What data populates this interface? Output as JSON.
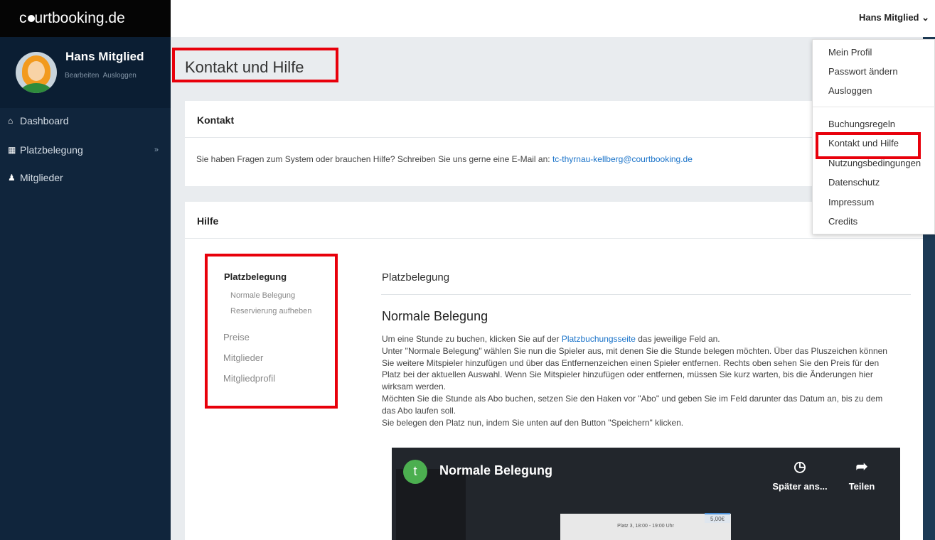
{
  "brand": {
    "pre": "c",
    "post": "urtbooking.de"
  },
  "user": {
    "name": "Hans Mitglied",
    "edit": "Bearbeiten",
    "logout": "Ausloggen"
  },
  "nav": [
    {
      "label": "Dashboard",
      "icon": "home-icon"
    },
    {
      "label": "Platzbelegung",
      "icon": "calendar-icon",
      "chevron": "»"
    },
    {
      "label": "Mitglieder",
      "icon": "person-icon"
    }
  ],
  "topbar": {
    "user_menu": "Hans Mitglied ⌄"
  },
  "page": {
    "title": "Kontakt und Hilfe"
  },
  "contact": {
    "heading": "Kontakt",
    "text": "Sie haben Fragen zum System oder brauchen Hilfe? Schreiben Sie uns gerne eine E-Mail an: ",
    "email": "tc-thyrnau-kellberg@courtbooking.de"
  },
  "help": {
    "heading": "Hilfe",
    "nav": {
      "active": "Platzbelegung",
      "sub1": "Normale Belegung",
      "sub2": "Reservierung aufheben",
      "item1": "Preise",
      "item2": "Mitglieder",
      "item3": "Mitgliedprofil"
    },
    "section_title": "Platzbelegung",
    "sub_title": "Normale Belegung",
    "p1_pre": "Um eine Stunde zu buchen, klicken Sie auf der ",
    "p1_link": "Platzbuchungsseite",
    "p1_post": " das jeweilige Feld an.",
    "p2": "Unter \"Normale Belegung\" wählen Sie nun die Spieler aus, mit denen Sie die Stunde belegen möchten. Über das Pluszeichen können Sie weitere Mitspieler hinzufügen und über das Entfernenzeichen einen Spieler entfernen. Rechts oben sehen Sie den Preis für den Platz bei der aktuellen Auswahl. Wenn Sie Mitspieler hinzufügen oder entfernen, müssen Sie kurz warten, bis die Änderungen hier wirksam werden.",
    "p3": "Möchten Sie die Stunde als Abo buchen, setzen Sie den Haken vor \"Abo\" und geben Sie im Feld darunter das Datum an, bis zu dem das Abo laufen soll.",
    "p4": "Sie belegen den Platz nun, indem Sie unten auf den Button \"Speichern\" klicken."
  },
  "video": {
    "channel_initial": "t",
    "title": "Normale Belegung",
    "watch_later": "Später ans...",
    "share": "Teilen",
    "modal_text": "Platz 3, 18:00 - 19:00 Uhr",
    "price": "5,00€"
  },
  "dropdown": {
    "items": [
      "Mein Profil",
      "Passwort ändern",
      "Ausloggen",
      "Buchungsregeln",
      "Kontakt und Hilfe",
      "Nutzungsbedingungen",
      "Datenschutz",
      "Impressum",
      "Credits"
    ]
  },
  "colors": {
    "highlight": "#e8000b",
    "sidebar": "#10253c",
    "link": "#1a73c9"
  }
}
